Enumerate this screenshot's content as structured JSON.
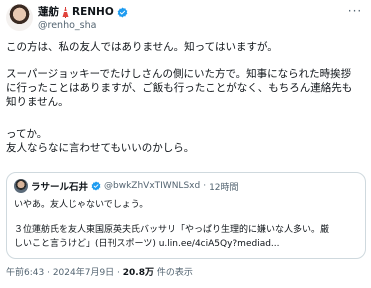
{
  "author": {
    "display_name": "蓮舫",
    "display_name_latin": "RENHO",
    "handle": "@renho_sha",
    "more_label": "···"
  },
  "tweet": {
    "line1": "この方は、私の友人ではありません。知ってはいますが。",
    "line2": "スーパージョッキーでたけしさんの側にいた方で。知事になられた時挨拶",
    "line3": "に行ったことはありますが、ご飯も行ったことがなく、もちろん連絡先も",
    "line4": "知りません。",
    "line5": "ってか。",
    "line6": "友人ならなに言わせてもいいのかしら。"
  },
  "quote": {
    "name": "ラサール石井",
    "handle": "@bwkZhVxTIWNLSxd",
    "separator": "·",
    "time": "12時間",
    "line1": "いやあ。友人じゃないでしょう。",
    "line2": "３位蓮舫氏を友人東国原英夫氏バッサリ「やっぱり生理的に嫌いな人多い。厳",
    "line3": "しいこと言うけど」(日刊スポーツ) u.lin.ee/4ciA5Qy?mediad..."
  },
  "meta": {
    "time": "午前6:43",
    "sep1": " · ",
    "date": "2024年7月9日",
    "sep2": " · ",
    "views": "20.8万",
    "views_label": " 件の表示"
  },
  "colors": {
    "verified": "#1d9bf0",
    "secondary_text": "#536471",
    "border": "#cfd9de"
  }
}
